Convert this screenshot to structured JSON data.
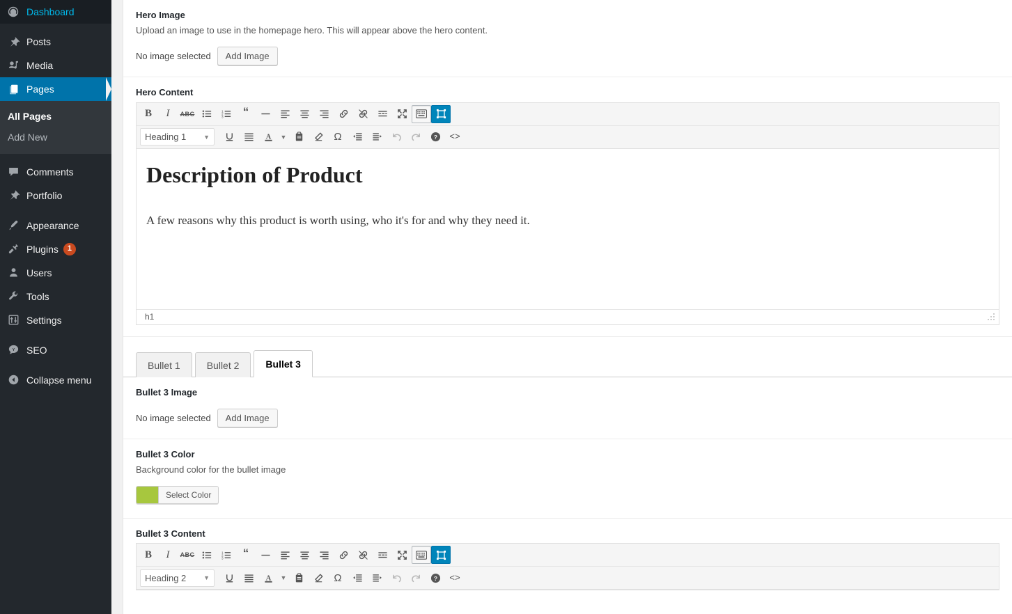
{
  "sidebar": {
    "items": [
      {
        "label": "Dashboard",
        "icon": "dashboard-icon",
        "active": false
      },
      {
        "label": "Posts",
        "icon": "pin-icon",
        "active": false
      },
      {
        "label": "Media",
        "icon": "media-icon",
        "active": false
      },
      {
        "label": "Pages",
        "icon": "pages-icon",
        "active": true
      },
      {
        "label": "Comments",
        "icon": "comment-icon",
        "active": false
      },
      {
        "label": "Portfolio",
        "icon": "pin-icon",
        "active": false
      },
      {
        "label": "Appearance",
        "icon": "appearance-icon",
        "active": false
      },
      {
        "label": "Plugins",
        "icon": "plugin-icon",
        "active": false,
        "badge": "1"
      },
      {
        "label": "Users",
        "icon": "user-icon",
        "active": false
      },
      {
        "label": "Tools",
        "icon": "wrench-icon",
        "active": false
      },
      {
        "label": "Settings",
        "icon": "settings-icon",
        "active": false
      },
      {
        "label": "SEO",
        "icon": "seo-icon",
        "active": false
      },
      {
        "label": "Collapse menu",
        "icon": "collapse-icon",
        "active": false
      }
    ],
    "submenu": [
      {
        "label": "All Pages",
        "current": true
      },
      {
        "label": "Add New",
        "current": false
      }
    ],
    "badge_color": "#ca4a1f",
    "active_color": "#0073aa"
  },
  "hero_image": {
    "label": "Hero Image",
    "description": "Upload an image to use in the homepage hero. This will appear above the hero content.",
    "status": "No image selected",
    "button": "Add Image"
  },
  "hero_content": {
    "label": "Hero Content",
    "format_select": "Heading 1",
    "heading": "Description of Product",
    "paragraph": "A few reasons why this product is worth using, who it's for and why they need it.",
    "statusbar_path": "h1"
  },
  "tabs": [
    {
      "label": "Bullet 1",
      "active": false
    },
    {
      "label": "Bullet 2",
      "active": false
    },
    {
      "label": "Bullet 3",
      "active": true
    }
  ],
  "bullet3_image": {
    "label": "Bullet 3 Image",
    "status": "No image selected",
    "button": "Add Image"
  },
  "bullet3_color": {
    "label": "Bullet 3 Color",
    "description": "Background color for the bullet image",
    "button": "Select Color",
    "value": "#a7c73e"
  },
  "bullet3_content": {
    "label": "Bullet 3 Content",
    "format_select": "Heading 2"
  },
  "toolbar": {
    "row1": [
      {
        "name": "bold-icon",
        "glyph": "B",
        "kind": "bold"
      },
      {
        "name": "italic-icon",
        "glyph": "I",
        "kind": "ital"
      },
      {
        "name": "strikethrough-icon",
        "glyph": "ABC",
        "kind": "strike"
      },
      {
        "name": "bulleted-list-icon",
        "kind": "ul"
      },
      {
        "name": "numbered-list-icon",
        "kind": "ol"
      },
      {
        "name": "blockquote-icon",
        "glyph": "“",
        "kind": "quote"
      },
      {
        "name": "horizontal-rule-icon",
        "kind": "hr"
      },
      {
        "name": "align-left-icon",
        "kind": "alignleft"
      },
      {
        "name": "align-center-icon",
        "kind": "aligncenter"
      },
      {
        "name": "align-right-icon",
        "kind": "alignright"
      },
      {
        "name": "insert-link-icon",
        "kind": "link"
      },
      {
        "name": "remove-link-icon",
        "kind": "unlink"
      },
      {
        "name": "read-more-icon",
        "kind": "more"
      },
      {
        "name": "distraction-free-icon",
        "kind": "fullscreen"
      },
      {
        "name": "toolbar-toggle-icon",
        "kind": "kitchensink",
        "state": "pressed"
      },
      {
        "name": "page-builder-icon",
        "kind": "pagebuilder",
        "state": "on"
      }
    ],
    "row2": [
      {
        "name": "underline-icon",
        "kind": "underline"
      },
      {
        "name": "justify-icon",
        "kind": "justify"
      },
      {
        "name": "text-color-icon",
        "kind": "textcolor"
      },
      {
        "name": "text-color-dropdown-icon",
        "kind": "caret"
      },
      {
        "name": "paste-as-text-icon",
        "kind": "paste"
      },
      {
        "name": "clear-formatting-icon",
        "kind": "eraser"
      },
      {
        "name": "special-character-icon",
        "glyph": "Ω",
        "kind": "omega"
      },
      {
        "name": "decrease-indent-icon",
        "kind": "outdent"
      },
      {
        "name": "increase-indent-icon",
        "kind": "indent"
      },
      {
        "name": "undo-icon",
        "kind": "undo"
      },
      {
        "name": "redo-icon",
        "kind": "redo"
      },
      {
        "name": "keyboard-shortcuts-icon",
        "kind": "help"
      },
      {
        "name": "source-code-icon",
        "glyph": "<>",
        "kind": "code"
      }
    ]
  }
}
